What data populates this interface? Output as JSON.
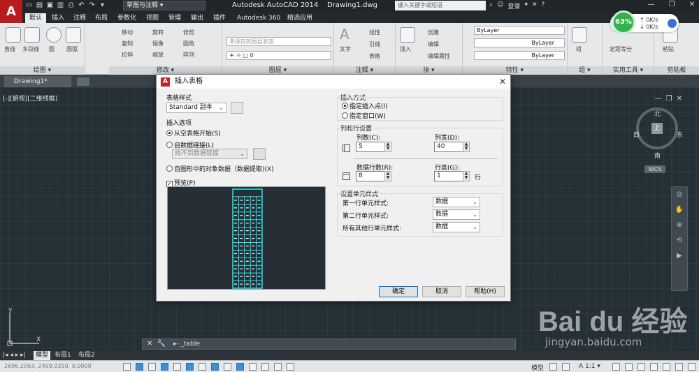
{
  "app": {
    "logo": "A",
    "workspace": "草图与注释",
    "title": "Autodesk AutoCAD 2014",
    "document": "Drawing1.dwg",
    "search_placeholder": "键入关键字或短语",
    "login": "登录"
  },
  "ribbon_tabs": [
    "默认",
    "插入",
    "注释",
    "布局",
    "参数化",
    "视图",
    "管理",
    "输出",
    "插件",
    "Autodesk 360",
    "精选应用"
  ],
  "ribbon": {
    "draw": {
      "label": "绘图",
      "items": [
        "直线",
        "多段线",
        "圆",
        "圆弧"
      ]
    },
    "modify": {
      "label": "修改",
      "items": [
        "移动",
        "旋转",
        "修剪",
        "复制",
        "镜像",
        "圆角",
        "拉伸",
        "缩放",
        "阵列"
      ]
    },
    "layers": {
      "label": "图层",
      "unsaved": "未保存的图层状态",
      "current": "0"
    },
    "annotation": {
      "label": "注释",
      "items": [
        "文字",
        "线性",
        "引线",
        "表格"
      ]
    },
    "block": {
      "label": "块",
      "items": [
        "插入",
        "创建",
        "编辑",
        "编辑属性"
      ]
    },
    "properties": {
      "label": "特性",
      "bylayer": [
        "ByLayer",
        "ByLayer",
        "ByLayer"
      ]
    },
    "groups": {
      "label": "组",
      "item": "组"
    },
    "utilities": {
      "label": "实用工具",
      "item": "定距等分"
    },
    "clipboard": {
      "label": "剪贴板",
      "item": "粘贴"
    }
  },
  "network": {
    "percent": "63%",
    "up": "0K/s",
    "down": "0K/s"
  },
  "file_tab": "Drawing1*",
  "viewport_label": "[-][俯视][二维线框]",
  "viewcube": {
    "n": "北",
    "s": "南",
    "e": "东",
    "w": "西",
    "top": "上",
    "wcs": "WCS"
  },
  "ucs": {
    "x": "X",
    "y": "Y"
  },
  "command_line": "_table",
  "layout_tabs": [
    "模型",
    "布局1",
    "布局2"
  ],
  "status": {
    "coords": "2696.2063, 2459.0310, 0.0000",
    "model": "模型",
    "scale": "1:1"
  },
  "dialog": {
    "title": "插入表格",
    "table_style": {
      "label": "表格样式",
      "value": "Standard 副本"
    },
    "insert_options": {
      "label": "插入选项",
      "opt_empty": "从空表格开始(S)",
      "opt_datalink": "自数据链接(L)",
      "datalink_value": "找不到数据链接",
      "opt_extract": "自图形中的对象数据（数据提取)(X)"
    },
    "preview_label": "预览(P)",
    "insert_method": {
      "label": "插入方式",
      "opt_point": "指定插入点(I)",
      "opt_window": "指定窗口(W)"
    },
    "colrow": {
      "label": "列和行设置",
      "cols_label": "列数(C):",
      "cols": "5",
      "colwidth_label": "列宽(D):",
      "colwidth": "40",
      "rows_label": "数据行数(R):",
      "rows": "8",
      "rowheight_label": "行高(G):",
      "rowheight": "1",
      "unit_row": "行"
    },
    "cellstyle": {
      "label": "设置单元样式",
      "row1_label": "第一行单元样式:",
      "row1_value": "数据",
      "row2_label": "第二行单元样式:",
      "row2_value": "数据",
      "other_label": "所有其他行单元样式:",
      "other_value": "数据"
    },
    "ok": "确定",
    "cancel": "取消",
    "help": "帮助(H)"
  },
  "watermark": {
    "brand": "Bai du 经验",
    "url": "jingyan.baidu.com"
  }
}
